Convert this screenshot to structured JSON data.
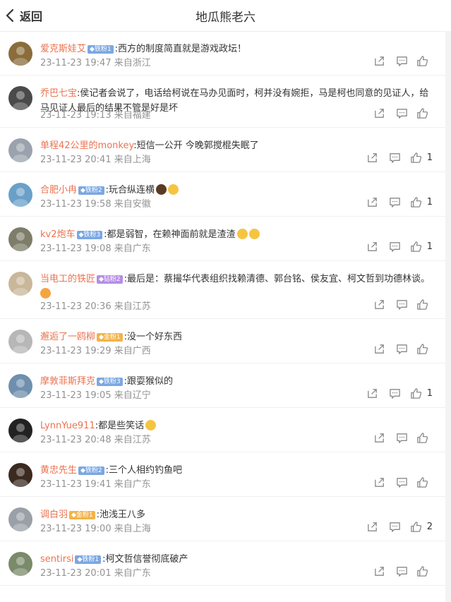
{
  "header": {
    "back_label": "返回",
    "title": "地瓜熊老六"
  },
  "comments": [
    {
      "user": "爱克斯娃艾",
      "badge": "铁粉1",
      "badge_color": "blue",
      "text": ":西方的制度简直就是游戏政坛！",
      "text2": "",
      "emojis": [],
      "time": "23-11-23 19:47 来自浙江",
      "likes": "",
      "avatar_color": "#8a6d3b"
    },
    {
      "user": "乔巴七宝",
      "badge": "",
      "badge_color": "",
      "text": ":侯记者会说了，电话给柯说在马办见面时，柯并没有婉拒，马是柯也同意的见证人，给",
      "text2": "马见证人最后的结果不管是好是坏",
      "emojis": [],
      "time": "23-11-23 19:13 来自福建",
      "likes": "",
      "avatar_color": "#4a4a4a"
    },
    {
      "user": "单程42公里的monkey",
      "badge": "",
      "badge_color": "",
      "text": ":短信一公开 今晚郭搅棍失眠了",
      "text2": "",
      "emojis": [],
      "time": "23-11-23 20:41 来自上海",
      "likes": "1",
      "avatar_color": "#9aa3ad"
    },
    {
      "user": "合肥小冉",
      "badge": "铁粉2",
      "badge_color": "blue",
      "text": ":玩合纵连横",
      "text2": "",
      "emojis": [
        "#5a3a22",
        "#f5c542"
      ],
      "time": "23-11-23 19:58 来自安徽",
      "likes": "1",
      "avatar_color": "#6aa0c8"
    },
    {
      "user": "kv2炮车",
      "badge": "铁粉3",
      "badge_color": "blue",
      "text": ":都是弱智，在赖神面前就是渣渣",
      "text2": "",
      "emojis": [
        "#f5c542",
        "#f5c542"
      ],
      "time": "23-11-23 19:08 来自广东",
      "likes": "1",
      "avatar_color": "#7d7d6a"
    },
    {
      "user": "当电工的铁匠",
      "badge": "钻粉2",
      "badge_color": "purple",
      "text": ":最后是：蔡撮华代表组织找赖清德、郭台铭、侯友宜、柯文哲到功德林谈。",
      "text2": "",
      "emojis": [
        "#f5a442"
      ],
      "time": "23-11-23 20:36 来自江苏",
      "likes": "",
      "avatar_color": "#c9b79a"
    },
    {
      "user": "邂逅了一鸥柳",
      "badge": "金粉1",
      "badge_color": "gold",
      "text": ":没一个好东西",
      "text2": "",
      "emojis": [],
      "time": "23-11-23 19:29 来自广西",
      "likes": "",
      "avatar_color": "#b7b7b7"
    },
    {
      "user": "摩敦菲斯拜克",
      "badge": "铁粉3",
      "badge_color": "blue",
      "text": ":跟耍猴似的",
      "text2": "",
      "emojis": [],
      "time": "23-11-23 19:05 来自辽宁",
      "likes": "1",
      "avatar_color": "#6f8fae"
    },
    {
      "user": "LynnYue911",
      "badge": "",
      "badge_color": "",
      "text": ":都是些笑话",
      "text2": "",
      "emojis": [
        "#f5c542"
      ],
      "time": "23-11-23 20:48 来自江苏",
      "likes": "",
      "avatar_color": "#222222"
    },
    {
      "user": "黄忠先生",
      "badge": "铁粉2",
      "badge_color": "blue",
      "text": ":三个人相约钓鱼吧",
      "text2": "",
      "emojis": [],
      "time": "23-11-23 19:41 来自广东",
      "likes": "",
      "avatar_color": "#3b2a20"
    },
    {
      "user": "调白羽",
      "badge": "金粉1",
      "badge_color": "gold",
      "text": ":池浅王八多",
      "text2": "",
      "emojis": [],
      "time": "23-11-23 19:00 来自上海",
      "likes": "2",
      "avatar_color": "#9aa0a8"
    },
    {
      "user": "sentirsi",
      "badge": "铁粉1",
      "badge_color": "blue",
      "text": ":柯文哲信誉彻底破产",
      "text2": "",
      "emojis": [],
      "time": "23-11-23 20:01 来自广东",
      "likes": "",
      "avatar_color": "#7a8a6a"
    }
  ]
}
